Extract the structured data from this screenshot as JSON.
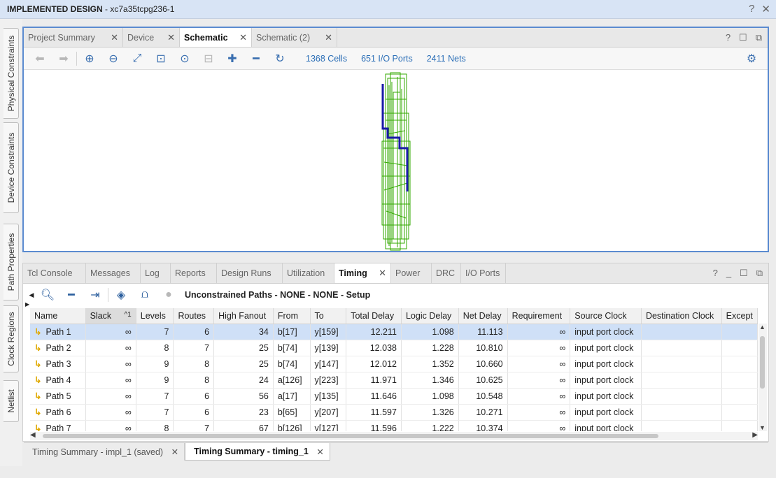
{
  "title": {
    "bold": "IMPLEMENTED DESIGN",
    "rest": " - xc7a35tcpg236-1",
    "help": "?",
    "close": "✕"
  },
  "sidebar": {
    "physical_constraints": "Physical Constraints",
    "device_constraints": "Device Constraints",
    "path_properties": "Path Properties",
    "clock_regions": "Clock Regions",
    "netlist": "Netlist"
  },
  "top_tabs": {
    "project_summary": "Project Summary",
    "device": "Device",
    "schematic": "Schematic",
    "schematic2": "Schematic (2)"
  },
  "schematic_stats": {
    "cells": "1368 Cells",
    "ports": "651 I/O Ports",
    "nets": "2411 Nets"
  },
  "bottom_tabs": {
    "tcl_console": "Tcl Console",
    "messages": "Messages",
    "log": "Log",
    "reports": "Reports",
    "design_runs": "Design Runs",
    "utilization": "Utilization",
    "timing": "Timing",
    "power": "Power",
    "drc": "DRC",
    "io_ports": "I/O Ports"
  },
  "timing": {
    "header_label": "Unconstrained Paths - NONE - NONE - Setup",
    "columns": {
      "name": "Name",
      "slack": "Slack",
      "slack_sort": "^1",
      "levels": "Levels",
      "routes": "Routes",
      "high_fanout": "High Fanout",
      "from": "From",
      "to": "To",
      "total_delay": "Total Delay",
      "logic_delay": "Logic Delay",
      "net_delay": "Net Delay",
      "requirement": "Requirement",
      "source_clock": "Source Clock",
      "destination_clock": "Destination Clock",
      "exception": "Except"
    },
    "rows": [
      {
        "name": "Path 1",
        "slack": "∞",
        "levels": "7",
        "routes": "6",
        "fanout": "34",
        "from": "b[17]",
        "to": "y[159]",
        "total": "12.211",
        "logic": "1.098",
        "net": "11.113",
        "req": "∞",
        "src": "input port clock"
      },
      {
        "name": "Path 2",
        "slack": "∞",
        "levels": "8",
        "routes": "7",
        "fanout": "25",
        "from": "b[74]",
        "to": "y[139]",
        "total": "12.038",
        "logic": "1.228",
        "net": "10.810",
        "req": "∞",
        "src": "input port clock"
      },
      {
        "name": "Path 3",
        "slack": "∞",
        "levels": "9",
        "routes": "8",
        "fanout": "25",
        "from": "b[74]",
        "to": "y[147]",
        "total": "12.012",
        "logic": "1.352",
        "net": "10.660",
        "req": "∞",
        "src": "input port clock"
      },
      {
        "name": "Path 4",
        "slack": "∞",
        "levels": "9",
        "routes": "8",
        "fanout": "24",
        "from": "a[126]",
        "to": "y[223]",
        "total": "11.971",
        "logic": "1.346",
        "net": "10.625",
        "req": "∞",
        "src": "input port clock"
      },
      {
        "name": "Path 5",
        "slack": "∞",
        "levels": "7",
        "routes": "6",
        "fanout": "56",
        "from": "a[17]",
        "to": "y[135]",
        "total": "11.646",
        "logic": "1.098",
        "net": "10.548",
        "req": "∞",
        "src": "input port clock"
      },
      {
        "name": "Path 6",
        "slack": "∞",
        "levels": "7",
        "routes": "6",
        "fanout": "23",
        "from": "b[65]",
        "to": "y[207]",
        "total": "11.597",
        "logic": "1.326",
        "net": "10.271",
        "req": "∞",
        "src": "input port clock"
      },
      {
        "name": "Path 7",
        "slack": "∞",
        "levels": "8",
        "routes": "7",
        "fanout": "67",
        "from": "b[126]",
        "to": "y[127]",
        "total": "11.596",
        "logic": "1.222",
        "net": "10.374",
        "req": "∞",
        "src": "input port clock"
      }
    ]
  },
  "summary_tabs": {
    "impl": "Timing Summary - impl_1 (saved)",
    "timing1": "Timing Summary - timing_1"
  },
  "colors": {
    "accent": "#5b8bd0",
    "selected_row": "#cfe0f7",
    "schematic_cells": "#33aa00",
    "critical_path": "#1a1aa8"
  }
}
